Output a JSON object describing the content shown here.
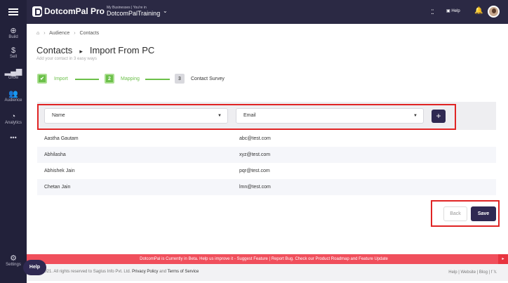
{
  "sidebar": {
    "items": [
      {
        "label": "Build",
        "icon": "plus-circle-icon"
      },
      {
        "label": "Sell",
        "icon": "dollar-icon"
      },
      {
        "label": "Grow",
        "icon": "bars-icon"
      },
      {
        "label": "Audience",
        "icon": "people-icon"
      },
      {
        "label": "Analytics",
        "icon": "analytics-icon"
      },
      {
        "label": "•••",
        "icon": "more-icon"
      }
    ],
    "settings_label": "Settings"
  },
  "topbar": {
    "brand": "DotcomPal Pro",
    "business_caption": "My Businesses | You're in",
    "business_name": "DotcomPalTraining",
    "help_label": "Help"
  },
  "breadcrumb": {
    "home_icon": "⌂",
    "items": [
      "Audience",
      "Contacts"
    ]
  },
  "page": {
    "title": "Contacts",
    "title_arrow": "▸",
    "title_sub": "Import From PC",
    "subtitle": "Add your contact in 3 easy ways"
  },
  "steps": [
    {
      "marker": "✔",
      "label": "Import"
    },
    {
      "marker": "2",
      "label": "Mapping"
    },
    {
      "marker": "3",
      "label": "Contact Survey"
    }
  ],
  "mapping": {
    "col1": "Name",
    "col2": "Email",
    "add_label": "+"
  },
  "rows": [
    {
      "name": "Aastha Gautam",
      "email": "abc@test.com"
    },
    {
      "name": "Abhilasha",
      "email": "xyz@test.com"
    },
    {
      "name": "Abhishek Jain",
      "email": "pqr@test.com"
    },
    {
      "name": "Chetan Jain",
      "email": "lmn@test.com"
    }
  ],
  "actions": {
    "back": "Back",
    "save": "Save"
  },
  "banner": {
    "text": "DotcomPal is Currently in Beta. Help us improve it - Suggest Feature | Report Bug. Check our Product Roadmap and Feature Update",
    "arrow": "▸"
  },
  "footer": {
    "copyright": "2021. All rights reserved to Saglus Info Pvt. Ltd.",
    "privacy": "Privacy Policy",
    "and": "and",
    "terms": "Terms of Service",
    "links": "Help  |  Website  |  Blog  |  f  𝕏"
  },
  "help_button": "Help",
  "colors": {
    "sidebar": "#22213a",
    "topbar": "#2b2944",
    "accent": "#2f2952",
    "step_green": "#6cc04a",
    "banner_red": "#f04f5c",
    "highlight_red": "#e02424"
  }
}
